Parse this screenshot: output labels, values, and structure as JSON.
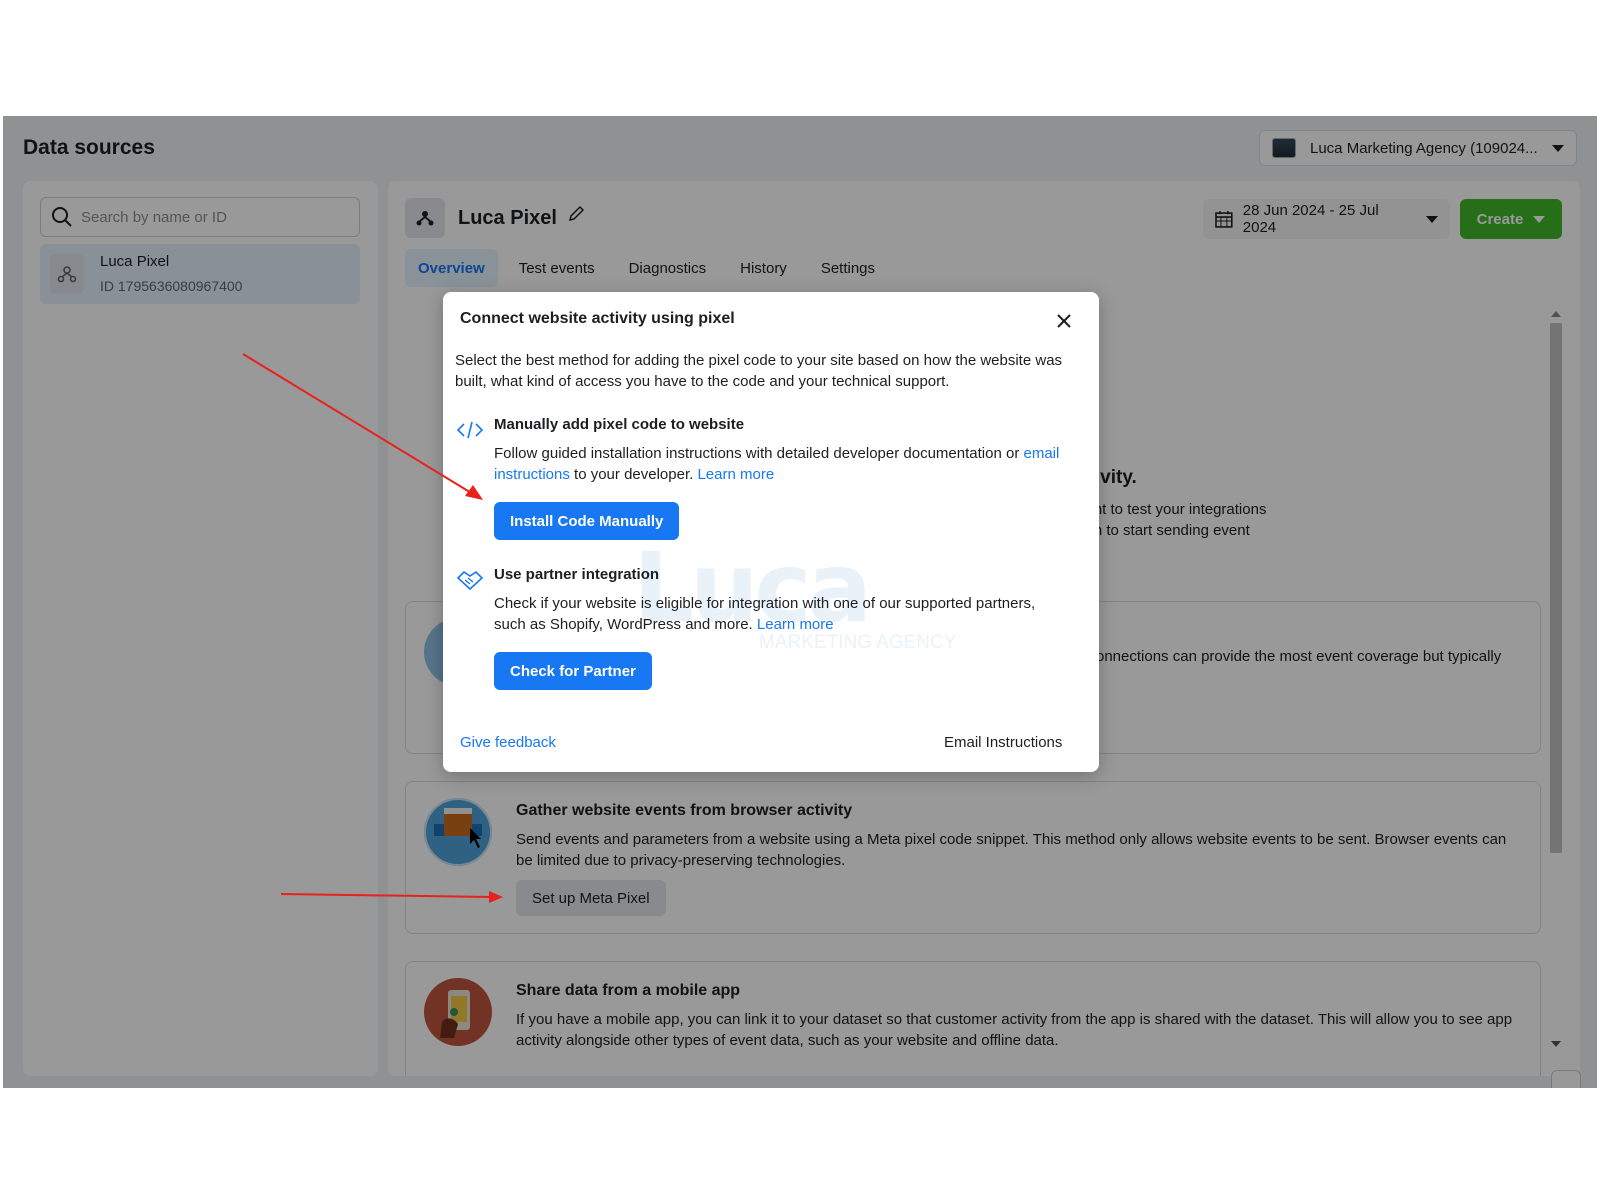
{
  "header": {
    "title": "Data sources",
    "account_name": "Luca Marketing Agency (109024..."
  },
  "sidebar": {
    "search_placeholder": "Search by name or ID",
    "items": [
      {
        "name": "Luca Pixel",
        "id": "ID 1795636080967400"
      }
    ]
  },
  "main": {
    "pixel_name": "Luca Pixel",
    "date_range": "28 Jun 2024 - 25 Jul 2024",
    "create_label": "Create",
    "tabs": [
      {
        "label": "Overview",
        "active": true
      },
      {
        "label": "Test events",
        "active": false
      },
      {
        "label": "Diagnostics",
        "active": false
      },
      {
        "label": "History",
        "active": false
      },
      {
        "label": "Settings",
        "active": false
      }
    ],
    "partial_heading": "ctivity.",
    "partial_text_1": "vant to test your integrations",
    "partial_text_2": "tion to start sending event",
    "partial_text_3": "onnections can provide the most event coverage but typically",
    "cards": [
      {
        "title": "Gather website events from browser activity",
        "desc": "Send events and parameters from a website using a Meta pixel code snippet. This method only allows website events to be sent. Browser events can be limited due to privacy-preserving technologies.",
        "button": "Set up Meta Pixel"
      },
      {
        "title": "Share data from a mobile app",
        "desc": "If you have a mobile app, you can link it to your dataset so that customer activity from the app is shared with the dataset. This will allow you to see app activity alongside other types of event data, such as your website and offline data."
      }
    ]
  },
  "modal": {
    "title": "Connect website activity using pixel",
    "intro": "Select the best method for adding the pixel code to your site based on how the website was built, what kind of access you have to the code and your technical support.",
    "manual": {
      "title": "Manually add pixel code to website",
      "desc_prefix": "Follow guided installation instructions with detailed developer documentation or ",
      "email_link": "email instructions",
      "desc_middle": " to your developer. ",
      "learn_more": "Learn more",
      "button": "Install Code Manually"
    },
    "partner": {
      "title": "Use partner integration",
      "desc": "Check if your website is eligible for integration with one of our supported partners, such as Shopify, WordPress and more. ",
      "learn_more": "Learn more",
      "button": "Check for Partner"
    },
    "feedback": "Give feedback",
    "email_instructions": "Email Instructions",
    "watermark": "Luca",
    "watermark_sub": "MARKETING AGENCY"
  },
  "colors": {
    "accent": "#1877f2",
    "create_button": "#42b72a",
    "annotation_arrow": "#e8211b"
  },
  "icons": [
    "search-icon",
    "pixel-icon",
    "pencil-icon",
    "calendar-icon",
    "close-icon",
    "code-icon",
    "handshake-icon"
  ]
}
